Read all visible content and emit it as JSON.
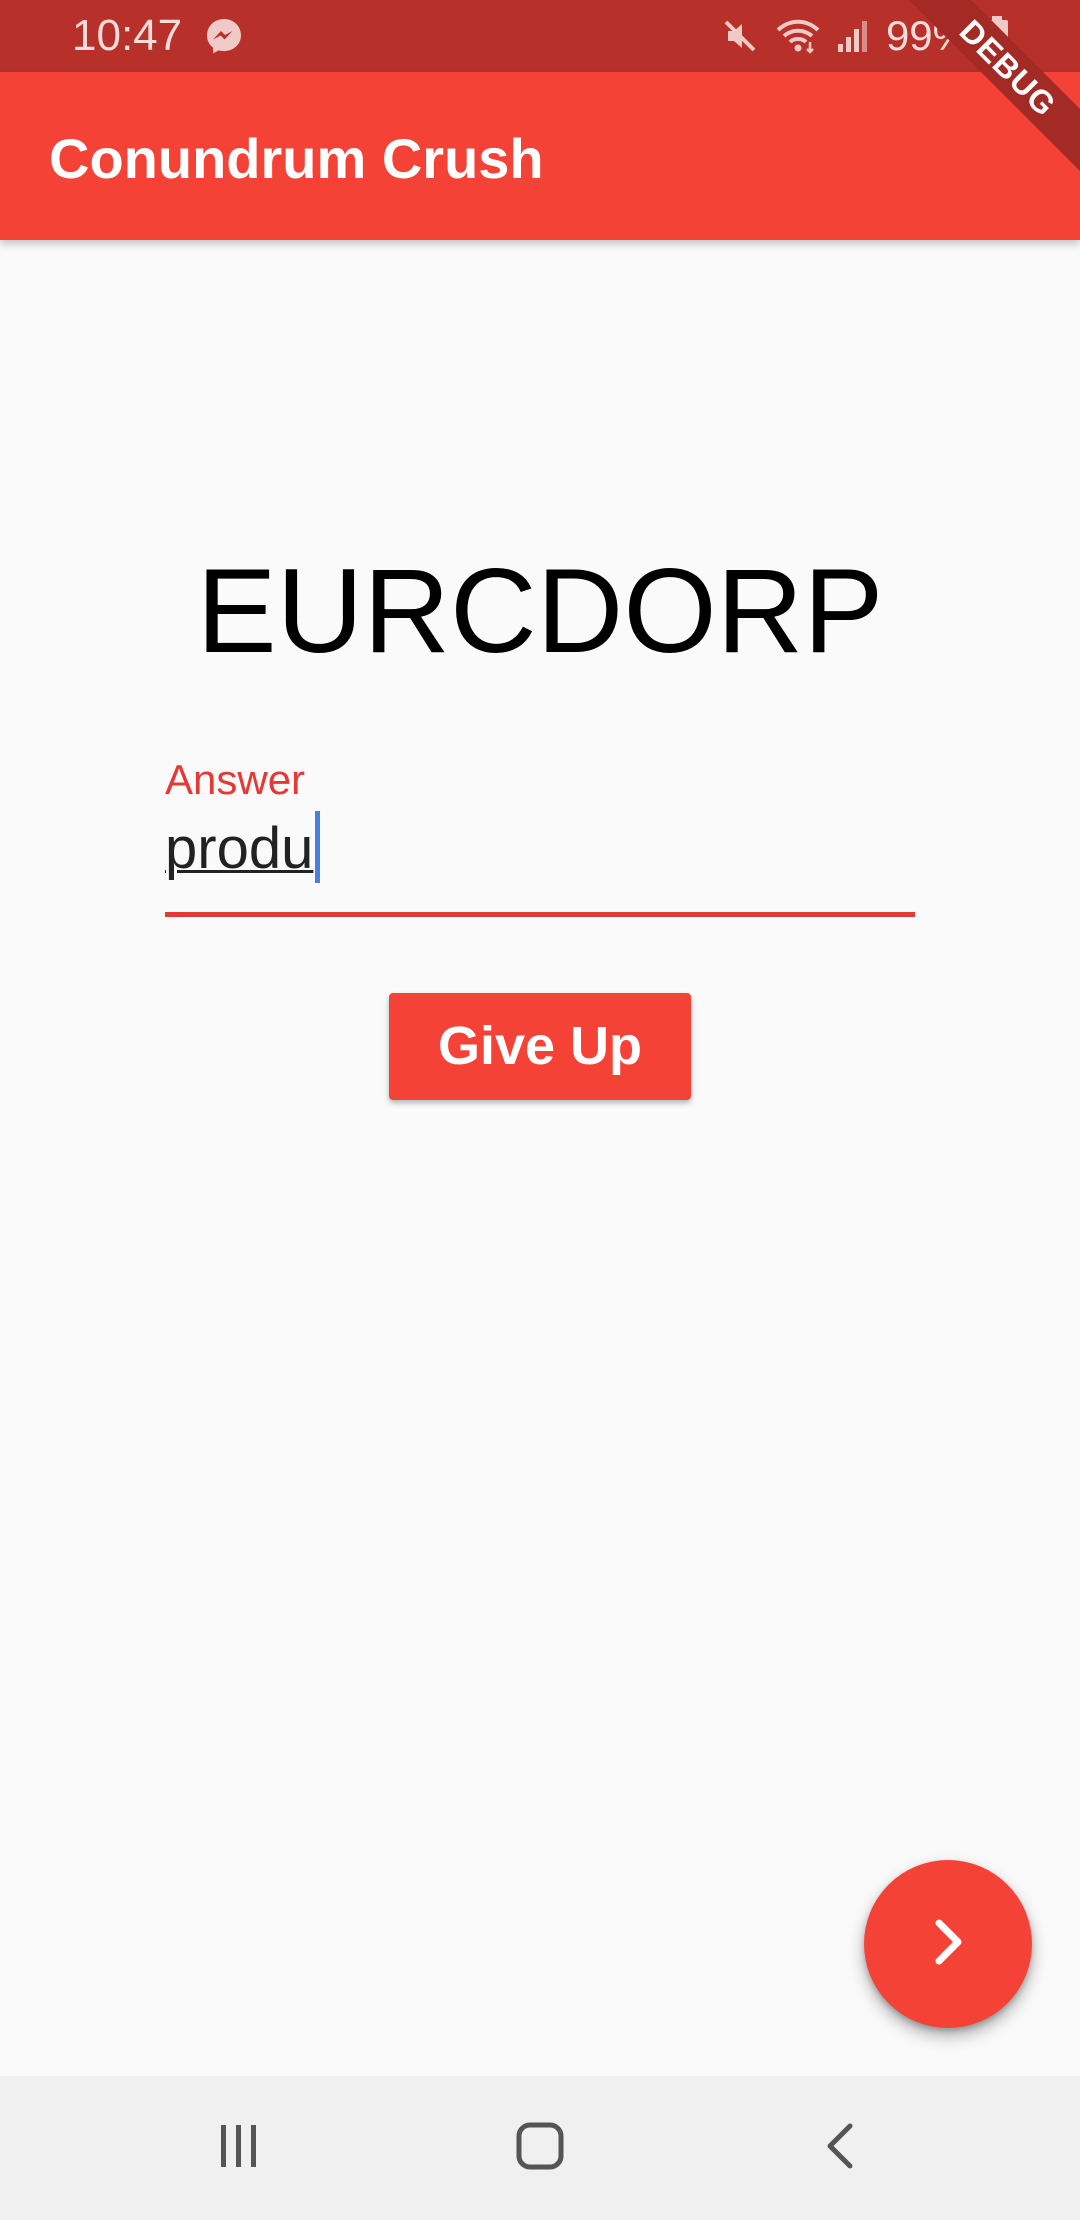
{
  "status_bar": {
    "time": "10:47",
    "battery": "99%",
    "icons": [
      "messenger-icon",
      "mute-icon",
      "wifi-icon",
      "signal-icon",
      "battery-icon"
    ]
  },
  "app_bar": {
    "title": "Conundrum Crush"
  },
  "debug_banner": "DEBUG",
  "puzzle": {
    "scrambled_word": "EURCDORP"
  },
  "answer": {
    "label": "Answer",
    "value": "produ"
  },
  "actions": {
    "give_up_label": "Give Up",
    "next_icon": "chevron-right-icon"
  },
  "nav_bar": {
    "icons": [
      "recent-apps-icon",
      "home-icon",
      "back-icon"
    ]
  },
  "colors": {
    "primary": "#f44336",
    "status_bar": "#b8302a",
    "accent_label": "#e53935",
    "caret": "#4a7fe0",
    "background": "#fafafa"
  }
}
